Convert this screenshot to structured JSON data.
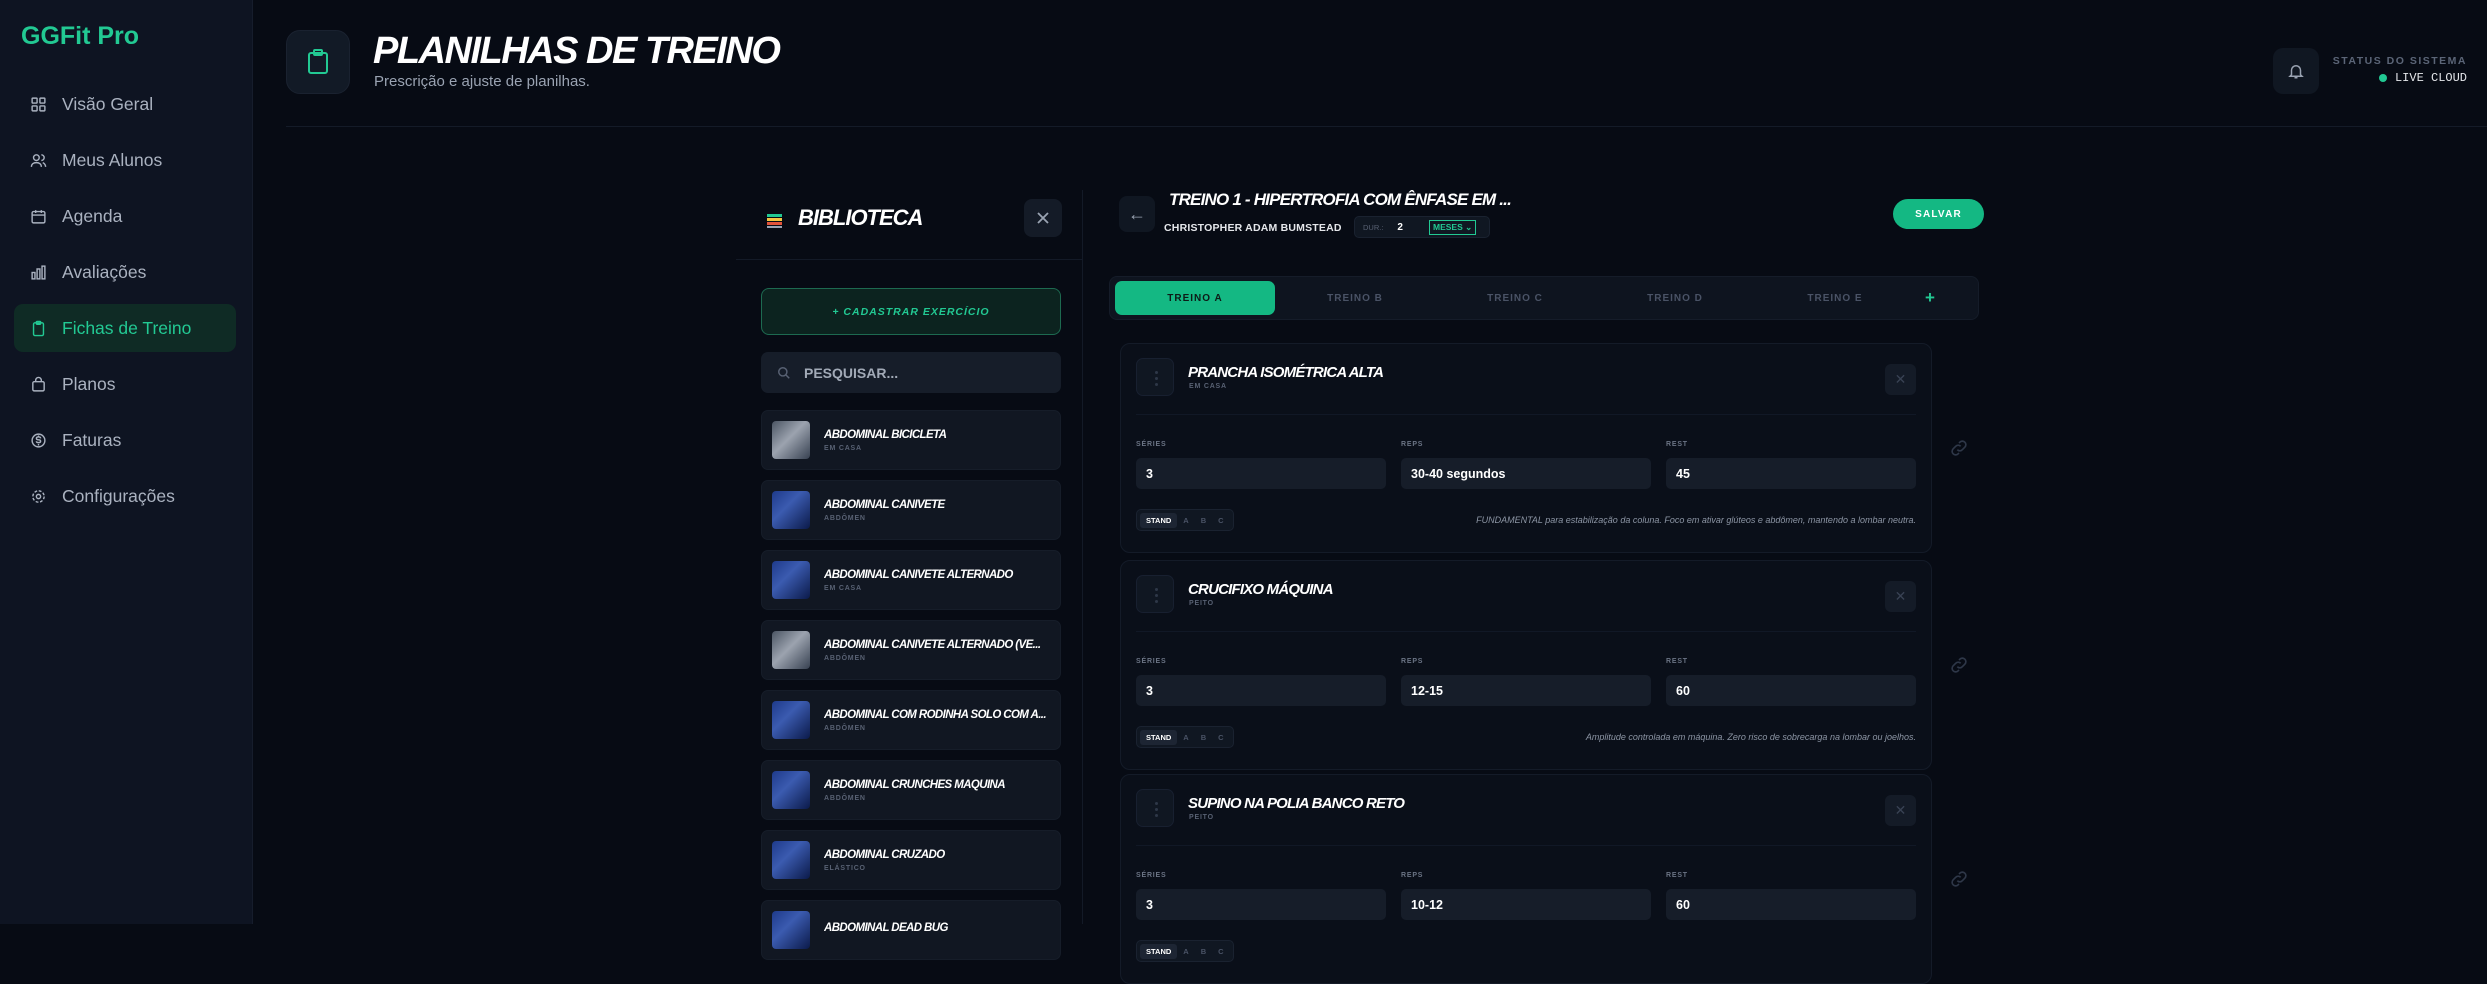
{
  "app": {
    "brand": "GGFit Pro"
  },
  "sidebar": {
    "items": [
      {
        "label": "Visão Geral",
        "icon": "grid-icon",
        "active": false
      },
      {
        "label": "Meus Alunos",
        "icon": "users-icon",
        "active": false
      },
      {
        "label": "Agenda",
        "icon": "calendar-icon",
        "active": false
      },
      {
        "label": "Avaliações",
        "icon": "bar-chart-icon",
        "active": false
      },
      {
        "label": "Fichas de Treino",
        "icon": "clipboard-icon",
        "active": true
      },
      {
        "label": "Planos",
        "icon": "bag-icon",
        "active": false
      },
      {
        "label": "Faturas",
        "icon": "dollar-icon",
        "active": false
      },
      {
        "label": "Configurações",
        "icon": "gear-icon",
        "active": false
      }
    ]
  },
  "header": {
    "title": "PLANILHAS DE TREINO",
    "subtitle": "Prescrição e ajuste de planilhas.",
    "status_label": "STATUS DO SISTEMA",
    "status_value": "LIVE CLOUD"
  },
  "library": {
    "title": "BIBLIOTECA",
    "add_button": "+ CADASTRAR EXERCÍCIO",
    "search_placeholder": "PESQUISAR...",
    "items": [
      {
        "name": "ABDOMINAL BICICLETA",
        "category": "EM CASA",
        "thumb": "gray"
      },
      {
        "name": "ABDOMINAL CANIVETE",
        "category": "ABDÔMEN",
        "thumb": "blue"
      },
      {
        "name": "ABDOMINAL CANIVETE ALTERNADO",
        "category": "EM CASA",
        "thumb": "blue"
      },
      {
        "name": "ABDOMINAL CANIVETE ALTERNADO (VE...",
        "category": "ABDÔMEN",
        "thumb": "gray"
      },
      {
        "name": "ABDOMINAL COM RODINHA SOLO COM A...",
        "category": "ABDÔMEN",
        "thumb": "blue"
      },
      {
        "name": "ABDOMINAL CRUNCHES MÁQUINA",
        "category": "ABDÔMEN",
        "thumb": "blue"
      },
      {
        "name": "ABDOMINAL CRUZADO",
        "category": "ELÁSTICO",
        "thumb": "blue"
      },
      {
        "name": "ABDOMINAL DEAD BUG",
        "category": "",
        "thumb": "blue"
      }
    ]
  },
  "workout": {
    "title": "TREINO 1 - HIPERTROFIA COM ÊNFASE EM ...",
    "student": "CHRISTOPHER ADAM BUMSTEAD",
    "duration_label": "DUR.:",
    "duration_value": "2",
    "duration_unit": "MESES",
    "save_label": "SALVAR",
    "tabs": [
      "TREINO A",
      "TREINO B",
      "TREINO C",
      "TREINO D",
      "TREINO E"
    ],
    "add_tab": "+",
    "field_labels": {
      "series": "SÉRIES",
      "reps": "REPS",
      "rest": "REST"
    },
    "exercises": [
      {
        "name": "PRANCHA ISOMÉTRICA ALTA",
        "category": "EM CASA",
        "series": "3",
        "reps": "30-40 segundos",
        "rest": "45",
        "sets": [
          "STAND",
          "A",
          "B",
          "C"
        ],
        "note": "FUNDAMENTAL para estabilização da coluna. Foco em ativar glúteos e abdômen, mantendo a lombar neutra."
      },
      {
        "name": "CRUCIFIXO MÁQUINA",
        "category": "PEITO",
        "series": "3",
        "reps": "12-15",
        "rest": "60",
        "sets": [
          "STAND",
          "A",
          "B",
          "C"
        ],
        "note": "Amplitude controlada em máquina. Zero risco de sobrecarga na lombar ou joelhos."
      },
      {
        "name": "SUPINO NA POLIA BANCO RETO",
        "category": "PEITO",
        "series": "3",
        "reps": "10-12",
        "rest": "60",
        "sets": [
          "STAND",
          "A",
          "B",
          "C"
        ],
        "note": ""
      }
    ]
  },
  "colors": {
    "accent": "#22c993",
    "background": "#070b14",
    "sidebar": "#0e1422"
  }
}
